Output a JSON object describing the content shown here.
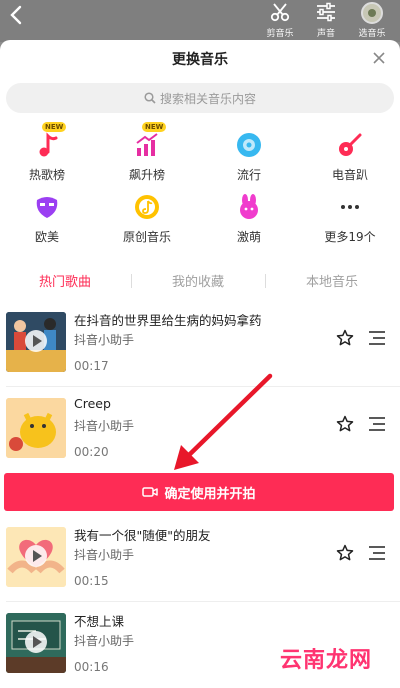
{
  "topbar": {
    "tools": [
      {
        "icon": "scissors-icon",
        "label": "剪音乐"
      },
      {
        "icon": "sliders-icon",
        "label": "声音"
      },
      {
        "icon": "music-avatar-icon",
        "label": "选音乐"
      }
    ]
  },
  "sheet": {
    "title": "更换音乐",
    "search_placeholder": "搜索相关音乐内容"
  },
  "categories": [
    {
      "icon": "hot-chart-icon",
      "label": "热歌榜",
      "badge": "NEW",
      "color": "#fe2c55"
    },
    {
      "icon": "rising-chart-icon",
      "label": "飙升榜",
      "badge": "NEW",
      "color": "#e62ea2"
    },
    {
      "icon": "disc-icon",
      "label": "流行",
      "color": "#37b8f0"
    },
    {
      "icon": "guitar-icon",
      "label": "电音趴",
      "color": "#fe2c55"
    },
    {
      "icon": "mask-icon",
      "label": "欧美",
      "color": "#9b3ff2"
    },
    {
      "icon": "original-music-icon",
      "label": "原创音乐",
      "color": "#ffc200"
    },
    {
      "icon": "cute-bunny-icon",
      "label": "激萌",
      "color": "#f03ccd"
    },
    {
      "icon": "more-dots-icon",
      "label": "更多19个",
      "color": "#333333"
    }
  ],
  "tabs": [
    "热门歌曲",
    "我的收藏",
    "本地音乐"
  ],
  "songs": [
    {
      "title": "在抖音的世界里给生病的妈妈拿药",
      "artist": "抖音小助手",
      "duration": "00:17"
    },
    {
      "title": "Creep",
      "artist": "抖音小助手",
      "duration": "00:20"
    },
    {
      "title": "我有一个很\"随便\"的朋友",
      "artist": "抖音小助手",
      "duration": "00:15"
    },
    {
      "title": "不想上课",
      "artist": "抖音小助手",
      "duration": "00:16"
    }
  ],
  "confirm_label": "确定使用并开拍",
  "watermark": "云南龙网",
  "colors": {
    "accent": "#fe2c55"
  }
}
